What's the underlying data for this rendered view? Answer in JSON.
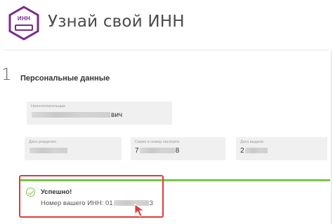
{
  "header": {
    "logo_text": "ИНН",
    "title": "Узнай свой ИНН"
  },
  "step": {
    "number": "1",
    "title": "Персональные данные"
  },
  "fields": {
    "fio": {
      "label": "Налогоплательщик",
      "value_start": "",
      "value_end": "вич"
    },
    "dob": {
      "label": "Дата рождения",
      "value_start": "",
      "value_end": ""
    },
    "passport": {
      "label": "Серия и номер паспорта",
      "value_start": "7",
      "value_end": "8"
    },
    "issue_date": {
      "label": "Дата выдачи",
      "value_start": "2",
      "value_end": ""
    }
  },
  "result": {
    "title": "Успешно!",
    "inn_label": "Номер вашего ИНН:",
    "inn_start": "01",
    "inn_end": "3"
  },
  "colors": {
    "brand": "#7a2a8a",
    "success": "#7cc24a",
    "highlight": "#e03a3a"
  },
  "icons": {
    "logo": "hexagon-inn-icon",
    "success": "check-circle-icon",
    "cursor": "mouse-pointer-icon"
  }
}
